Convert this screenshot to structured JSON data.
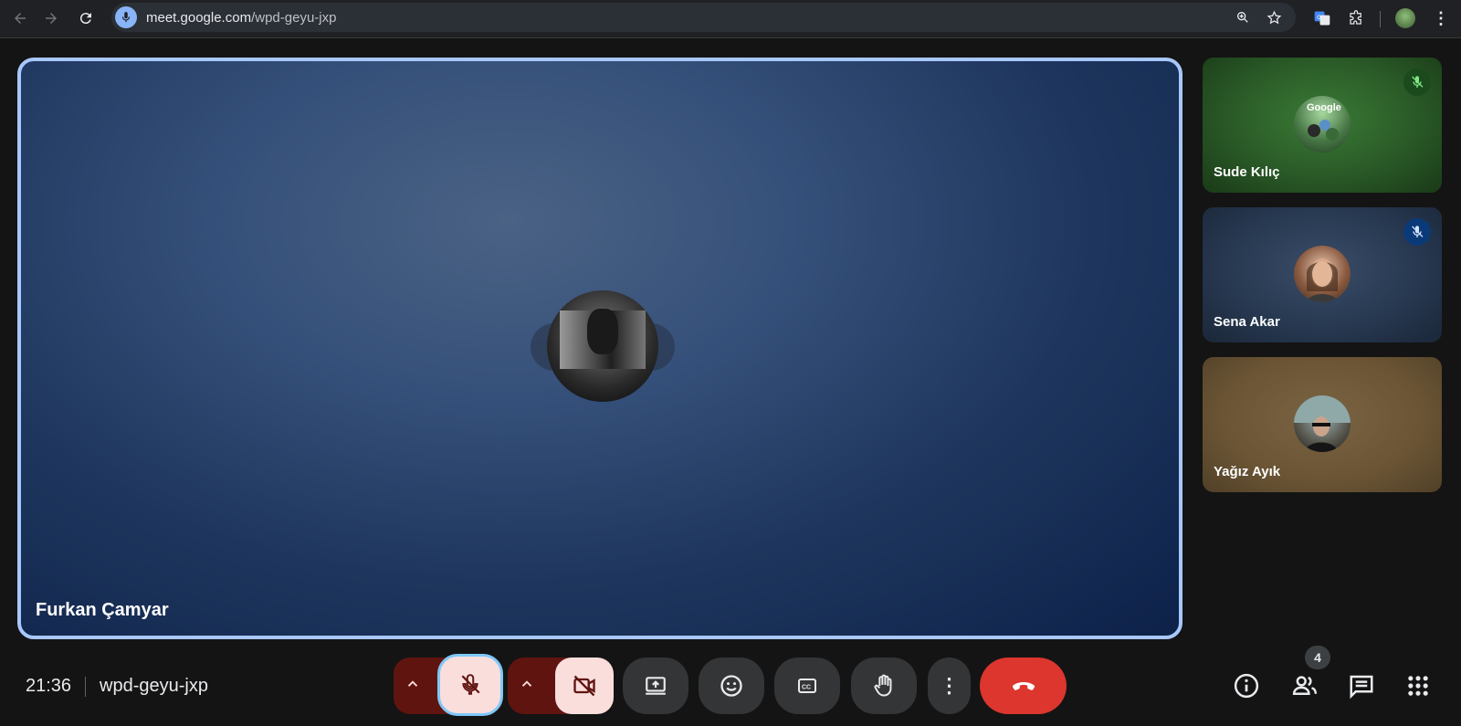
{
  "browser": {
    "url_host": "meet.google.com",
    "url_path": "/wpd-geyu-jxp",
    "back_icon": "back-arrow-icon",
    "forward_icon": "forward-arrow-icon",
    "reload_icon": "reload-icon"
  },
  "main_tile": {
    "participant_name": "Furkan Çamyar",
    "pin_icon": "pin-icon",
    "more_icon": "more-vert-icon"
  },
  "side_tiles": [
    {
      "name": "Sude Kılıç",
      "muted": true,
      "accent": "#1b4a1c"
    },
    {
      "name": "Sena Akar",
      "muted": true,
      "accent": "#0b3a78"
    },
    {
      "name": "Yağız Ayık",
      "muted": false
    }
  ],
  "bottom_bar": {
    "time": "21:36",
    "meeting_code": "wpd-geyu-jxp",
    "people_count": "4",
    "mic_state": "off",
    "camera_state": "off",
    "end_call_color": "#dc362e"
  }
}
